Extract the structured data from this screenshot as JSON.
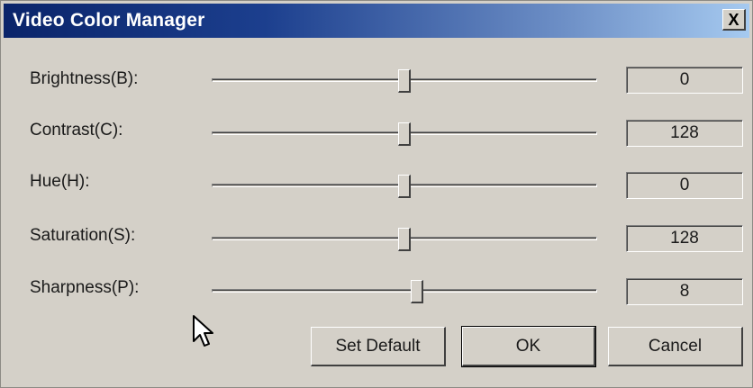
{
  "window": {
    "title": "Video Color Manager",
    "close_label": "X"
  },
  "controls": [
    {
      "label": "Brightness(B):",
      "value": "0",
      "slider_fraction": 0.5
    },
    {
      "label": "Contrast(C):",
      "value": "128",
      "slider_fraction": 0.5
    },
    {
      "label": "Hue(H):",
      "value": "0",
      "slider_fraction": 0.5
    },
    {
      "label": "Saturation(S):",
      "value": "128",
      "slider_fraction": 0.5
    },
    {
      "label": "Sharpness(P):",
      "value": "8",
      "slider_fraction": 0.533
    }
  ],
  "buttons": {
    "set_default": "Set Default",
    "ok": "OK",
    "cancel": "Cancel"
  },
  "colors": {
    "dialog_bg": "#d4d0c8",
    "title_start": "#0a246a",
    "title_end": "#a6caf0",
    "title_text": "#ffffff"
  },
  "icons": {
    "cursor": "arrow-cursor-icon",
    "close": "close-icon"
  }
}
